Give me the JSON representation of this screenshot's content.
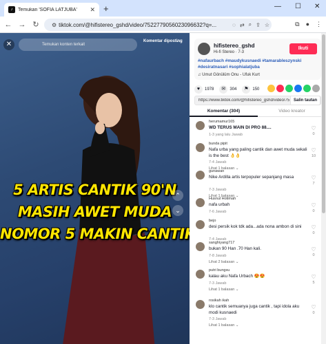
{
  "browser": {
    "tab_title": "Temukan 'SOFIA LATJUBA' ",
    "tab_close": "✕",
    "new_tab": "+",
    "url": "tiktok.com/@hifistereo_gshd/video/752277905602309663​2?q=...",
    "win_min": "—",
    "win_max": "☐",
    "win_close": "✕"
  },
  "video": {
    "search_placeholder": "Temukan konten terkait",
    "report_label": "Komentar diposting",
    "overlay_lines": [
      "5 ARTIS CANTIK 90'N",
      "MASIH AWET MUDA",
      "NOMOR 5 MAKIN CANTIK"
    ]
  },
  "author": {
    "username": "hifistereo_gshd",
    "subtitle": "Hi-fi Stereo · 7-3",
    "follow_label": "Ikuti",
    "hashtags": "#nafaurbach #maudykusnaedi #tamarableszynski #desiratnasari #sophialatjuba",
    "music": "♫ Umut Gönülüm Onu - Ufuk Kurt"
  },
  "stats": {
    "likes": "1978",
    "comments": "304",
    "saves": "150"
  },
  "colors": {
    "share": [
      "#fec43e",
      "#fe2c55",
      "#25d366",
      "#1877f2",
      "#25d366",
      "#aaaaaa"
    ]
  },
  "link": {
    "url": "https://www.tiktok.com/@hifistereo_gshd/video/75...",
    "copy_label": "Salin tautan"
  },
  "tabs": {
    "comments": "Komentar (304)",
    "creator": "Video kreator"
  },
  "comments": [
    {
      "user": "herumamur165",
      "text": "WD TERUS MAIN DI PRO 88....",
      "meta": "1-3 yang lalu   Jawab",
      "more": "",
      "count": "0",
      "bold": true
    },
    {
      "user": "bunda pipit",
      "text": "Nafa urba yang paling cantik dan awet muda sekali is the best 👌👌",
      "meta": "7-4   Jawab",
      "more": "Lihat 1 balasan ⌄",
      "count": "10"
    },
    {
      "user": "gunawan",
      "text": "Nike Ardilla artis terpopuler sepanjang masa",
      "meta": "7-3   Jawab",
      "more": "Lihat 1 balasan ⌄",
      "count": "7"
    },
    {
      "user": "Husnul Hotimah",
      "text": "nafa urbah",
      "meta": "7-6   Jawab",
      "more": "",
      "count": "0"
    },
    {
      "user": "bejo",
      "text": "desi persik kok tdk ada...ada nona ambon di sini",
      "meta": "7-4   Jawab",
      "more": "",
      "count": "0"
    },
    {
      "user": "sanghiyang717",
      "text": "bukan 90 Han .70 Han kali.",
      "meta": "7-8   Jawab",
      "more": "Lihat 2 balasan ⌄",
      "count": "0"
    },
    {
      "user": "putri bungsu",
      "text": "kalau aku Nafa Urbach 😍😍",
      "meta": "7-3   Jawab",
      "more": "Lihat 1 balasan ⌄",
      "count": "5"
    },
    {
      "user": "rosikah ikah",
      "text": "klo cantik semuanya juga cantik , tapi idola aku modi kusnaedi",
      "meta": "7-3   Jawab",
      "more": "Lihat 1 balasan ⌄",
      "count": "0"
    }
  ]
}
